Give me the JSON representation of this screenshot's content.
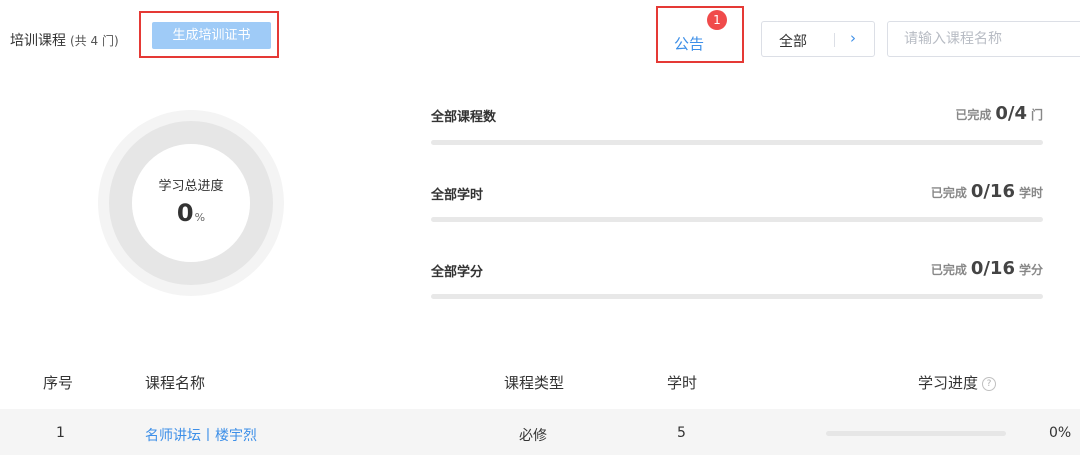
{
  "header": {
    "title": "培训课程",
    "course_count": "(共 4 门)",
    "generate_certificate_label": "生成培训证书",
    "notice_label": "公告",
    "notice_badge": "1",
    "filter_label": "全部",
    "filter_arrow": "›",
    "search_placeholder": "请输入课程名称"
  },
  "progress": {
    "title": "学习总进度",
    "value": "0",
    "unit": "%",
    "fraction": 0
  },
  "stats": [
    {
      "label": "全部课程数",
      "prefix": "已完成",
      "value": "0/4",
      "unit": "门",
      "fraction": 0
    },
    {
      "label": "全部学时",
      "prefix": "已完成",
      "value": "0/16",
      "unit": "学时",
      "fraction": 0
    },
    {
      "label": "全部学分",
      "prefix": "已完成",
      "value": "0/16",
      "unit": "学分",
      "fraction": 0
    }
  ],
  "table": {
    "columns": [
      "序号",
      "课程名称",
      "课程类型",
      "学时",
      "学习进度"
    ],
    "help_icon_glyph": "?",
    "rows": [
      {
        "index": "1",
        "name": "名师讲坛丨楼宇烈",
        "type": "必修",
        "hours": "5",
        "progress": "0%",
        "progress_fraction": 0
      }
    ]
  },
  "colors": {
    "accent": "#3d8fe8",
    "button_bg": "#9fcbf7",
    "highlight_border": "#e53935",
    "badge": "#f04b4b",
    "track": "#e8e8e8"
  },
  "icons": {
    "filter_arrow": "chevron-right-icon",
    "help": "question-circle-icon"
  }
}
